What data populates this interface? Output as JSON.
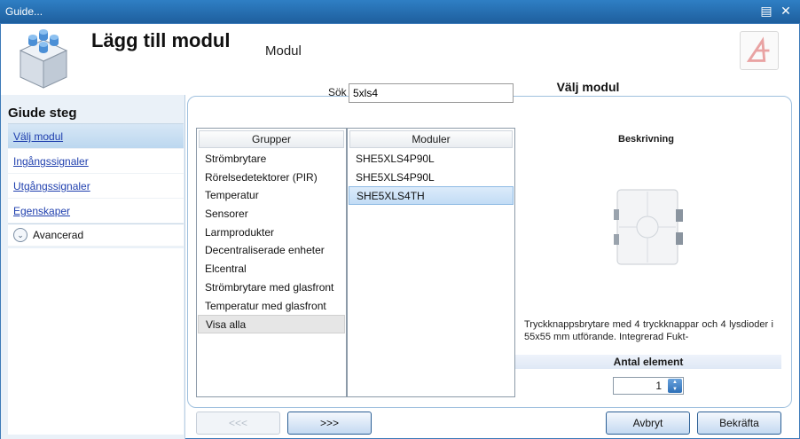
{
  "window": {
    "title": "Guide..."
  },
  "header": {
    "title": "Lägg till modul",
    "subtitle": "Modul"
  },
  "step_tab": {
    "label": "Välj modul"
  },
  "sidebar": {
    "heading": "Giude steg",
    "items": [
      {
        "label": "Välj modul"
      },
      {
        "label": "Ingångssignaler"
      },
      {
        "label": "Utgångssignaler"
      },
      {
        "label": "Egenskaper"
      }
    ],
    "advanced_label": "Avancerad"
  },
  "search": {
    "label": "Sök",
    "value": "5xls4"
  },
  "groups": {
    "header": "Grupper",
    "items": [
      "Strömbrytare",
      "Rörelsedetektorer (PIR)",
      "Temperatur",
      "Sensorer",
      "Larmprodukter",
      "Decentraliserade enheter",
      "Elcentral",
      "Strömbrytare med glasfront",
      "Temperatur med glasfront",
      "Visa alla"
    ],
    "selected": 9
  },
  "modules": {
    "header": "Moduler",
    "items": [
      "SHE5XLS4P90L",
      "SHE5XLS4P90L",
      "SHE5XLS4TH"
    ],
    "selected": 2
  },
  "description": {
    "title": "Beskrivning",
    "text": "Tryckknappsbrytare med 4 tryckknappar och 4 lysdioder i 55x55 mm utförande. Integrerad Fukt-"
  },
  "element_count": {
    "label": "Antal element",
    "value": "1"
  },
  "buttons": {
    "prev": "<<<",
    "next": ">>>",
    "cancel": "Avbryt",
    "confirm": "Bekräfta"
  },
  "colors": {
    "title_bar": "#1e5f9e",
    "selection": "#c2dcf5",
    "panel_border": "#9fc0de"
  }
}
